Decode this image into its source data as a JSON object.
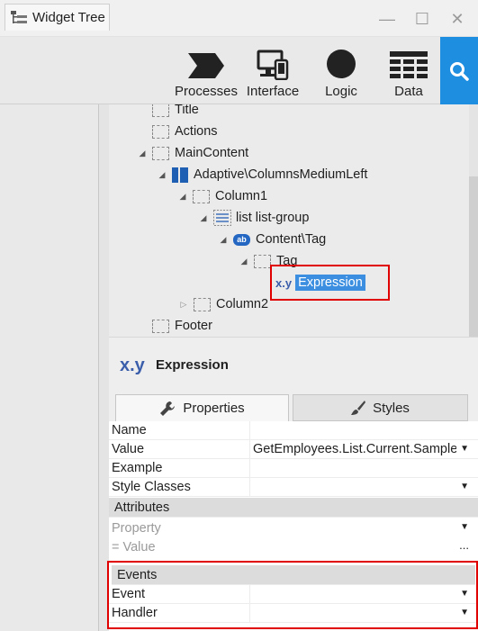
{
  "window": {
    "minimize_glyph": "—",
    "maximize_glyph": "☐",
    "close_glyph": "✕"
  },
  "toolbar": {
    "processes": "Processes",
    "interface": "Interface",
    "logic": "Logic",
    "data": "Data",
    "accent_color": "#1e8ee0"
  },
  "left_panel": {
    "tab_label": "Widget Tree"
  },
  "tree": {
    "nodes": [
      {
        "label": "Title"
      },
      {
        "label": "Actions"
      },
      {
        "label": "MainContent"
      },
      {
        "label": "Adaptive\\ColumnsMediumLeft"
      },
      {
        "label": "Column1"
      },
      {
        "label": "list list-group"
      },
      {
        "label": "Content\\Tag"
      },
      {
        "label": "Tag"
      },
      {
        "label": "Expression"
      },
      {
        "label": "Column2"
      },
      {
        "label": "Footer"
      }
    ]
  },
  "properties": {
    "icon_text": "x.y",
    "title": "Expression",
    "tab_properties": "Properties",
    "tab_styles": "Styles",
    "rows": {
      "name": {
        "key": "Name",
        "value": ""
      },
      "value": {
        "key": "Value",
        "value": "GetEmployees.List.Current.Sample"
      },
      "example": {
        "key": "Example",
        "value": ""
      },
      "style_classes": {
        "key": "Style Classes",
        "value": ""
      }
    },
    "attributes_header": "Attributes",
    "property_placeholder": "Property",
    "value_placeholder": "=  Value",
    "ellipsis": "...",
    "events_header": "Events",
    "event_key": "Event",
    "handler_key": "Handler"
  },
  "colors": {
    "selection": "#3b8ee0",
    "highlight_border": "#e00000"
  }
}
